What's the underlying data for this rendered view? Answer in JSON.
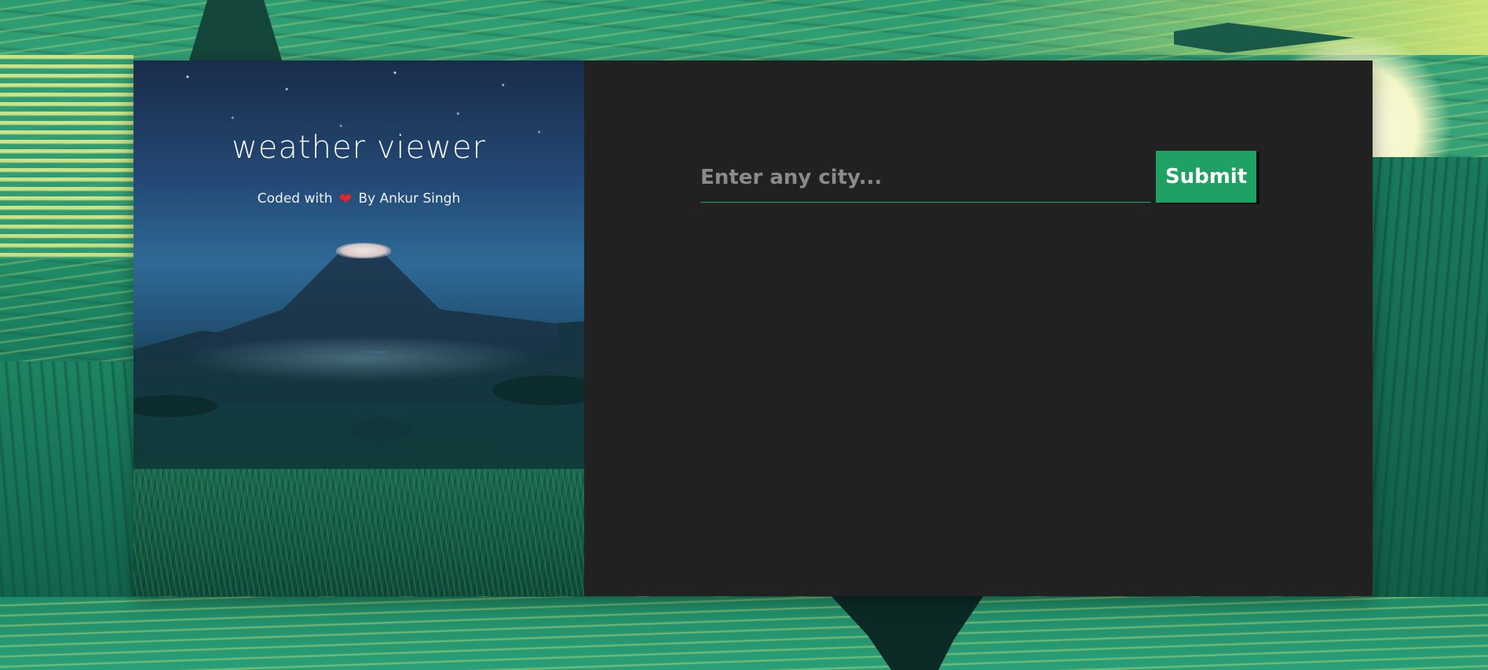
{
  "brand": {
    "title": "weather viewer",
    "credit_prefix": "Coded with",
    "credit_author": "By Ankur Singh",
    "heart_icon": "heart-icon",
    "heart_glyph": "❤"
  },
  "search": {
    "placeholder": "Enter any city...",
    "value": "",
    "submit_label": "Submit"
  },
  "colors": {
    "panel_background": "#212121",
    "accent_green": "#1fa163",
    "heart_red": "#e3262d"
  }
}
